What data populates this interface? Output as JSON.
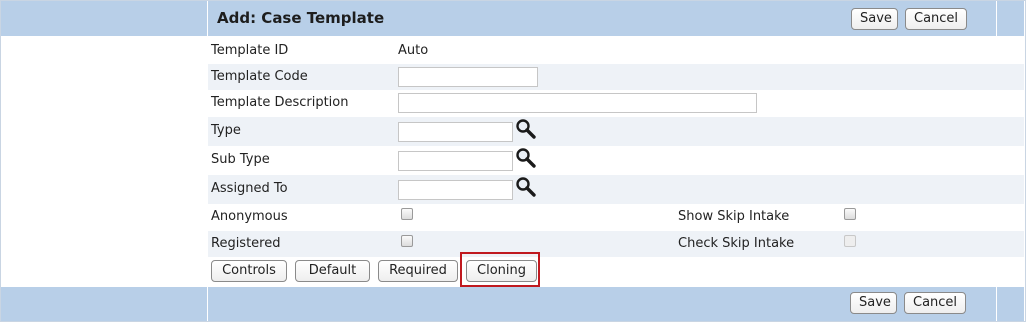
{
  "header": {
    "title": "Add: Case Template",
    "save_label": "Save",
    "cancel_label": "Cancel"
  },
  "fields": {
    "template_id": {
      "label": "Template ID",
      "value": "Auto"
    },
    "template_code": {
      "label": "Template Code",
      "value": ""
    },
    "template_description": {
      "label": "Template Description",
      "value": ""
    },
    "type": {
      "label": "Type",
      "value": ""
    },
    "sub_type": {
      "label": "Sub Type",
      "value": ""
    },
    "assigned_to": {
      "label": "Assigned To",
      "value": ""
    },
    "anonymous": {
      "label": "Anonymous",
      "checked": false
    },
    "registered": {
      "label": "Registered",
      "checked": false
    },
    "show_skip_intake": {
      "label": "Show Skip Intake",
      "checked": false
    },
    "check_skip_intake": {
      "label": "Check Skip Intake",
      "checked": false,
      "disabled": true
    }
  },
  "actions": {
    "controls": "Controls",
    "default": "Default",
    "required": "Required",
    "cloning": "Cloning"
  },
  "footer": {
    "save_label": "Save",
    "cancel_label": "Cancel"
  },
  "colors": {
    "band": "#b8cfe8",
    "alt_row": "#eef2f7",
    "highlight": "#c0191f"
  },
  "icons": {
    "lookup": "magnifier-icon"
  }
}
